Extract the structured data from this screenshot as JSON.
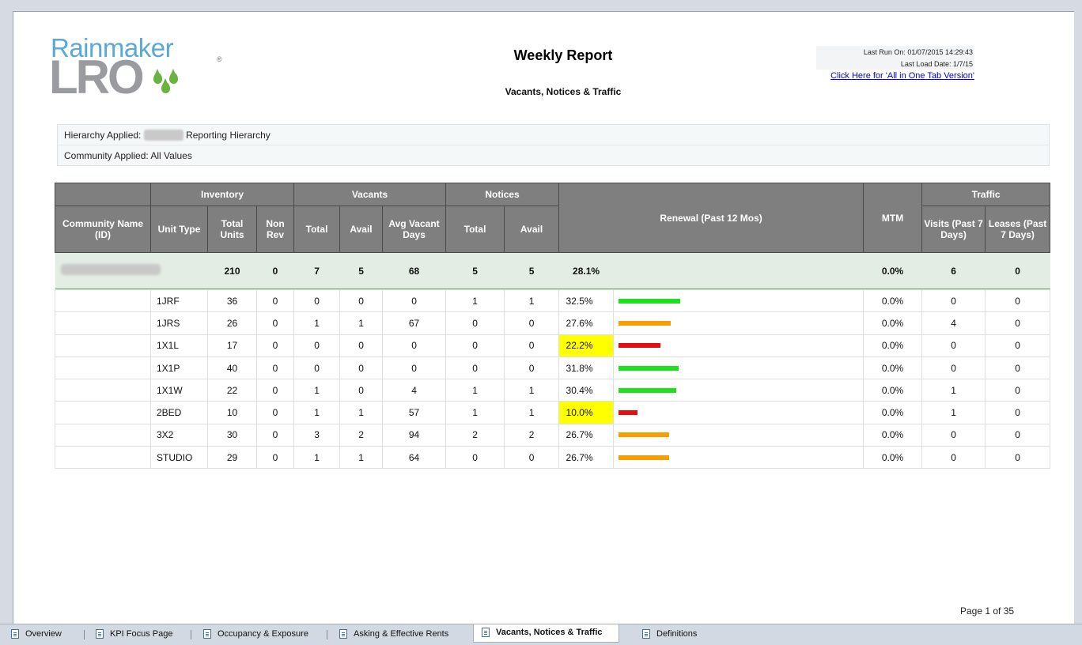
{
  "header": {
    "logo_top": "Rainmaker",
    "logo_bottom": "LRO",
    "logo_reg": "®",
    "title": "Weekly Report",
    "subtitle": "Vacants, Notices & Traffic",
    "last_run": "Last Run On: 01/07/2015 14:29:43",
    "last_load": "Last Load Date: 1/7/15",
    "all_in_one_link": "Click Here for 'All in One Tab Version'"
  },
  "filters": {
    "hierarchy_label": "Hierarchy Applied:",
    "hierarchy_value": "Reporting Hierarchy",
    "community_text": "Community Applied: All Values"
  },
  "table": {
    "groups": {
      "inventory": "Inventory",
      "vacants": "Vacants",
      "notices": "Notices",
      "renewal": "Renewal (Past 12 Mos)",
      "mtm": "MTM",
      "traffic": "Traffic"
    },
    "columns": {
      "community": "Community Name (ID)",
      "unit_type": "Unit Type",
      "total_units": "Total Units",
      "non_rev": "Non Rev",
      "vac_total": "Total",
      "vac_avail": "Avail",
      "avg_vacant_days": "Avg Vacant Days",
      "not_total": "Total",
      "not_avail": "Avail",
      "visits": "Visits (Past 7 Days)",
      "leases": "Leases (Past 7 Days)"
    },
    "summary": {
      "total_units": "210",
      "non_rev": "0",
      "vac_total": "7",
      "vac_avail": "5",
      "avg_vacant_days": "68",
      "not_total": "5",
      "not_avail": "5",
      "renewal": "28.1%",
      "mtm": "0.0%",
      "visits": "6",
      "leases": "0"
    },
    "rows": [
      {
        "unit_type": "1JRF",
        "total_units": "36",
        "non_rev": "0",
        "vac_total": "0",
        "vac_avail": "0",
        "avg_vacant_days": "0",
        "not_total": "1",
        "not_avail": "1",
        "renewal": "32.5%",
        "renewal_value": 32.5,
        "bar_color": "#1de11d",
        "highlight": false,
        "mtm": "0.0%",
        "visits": "0",
        "leases": "0"
      },
      {
        "unit_type": "1JRS",
        "total_units": "26",
        "non_rev": "0",
        "vac_total": "1",
        "vac_avail": "1",
        "avg_vacant_days": "67",
        "not_total": "0",
        "not_avail": "0",
        "renewal": "27.6%",
        "renewal_value": 27.6,
        "bar_color": "#f5a000",
        "highlight": false,
        "mtm": "0.0%",
        "visits": "4",
        "leases": "0"
      },
      {
        "unit_type": "1X1L",
        "total_units": "17",
        "non_rev": "0",
        "vac_total": "0",
        "vac_avail": "0",
        "avg_vacant_days": "0",
        "not_total": "0",
        "not_avail": "0",
        "renewal": "22.2%",
        "renewal_value": 22.2,
        "bar_color": "#e41010",
        "highlight": true,
        "mtm": "0.0%",
        "visits": "0",
        "leases": "0"
      },
      {
        "unit_type": "1X1P",
        "total_units": "40",
        "non_rev": "0",
        "vac_total": "0",
        "vac_avail": "0",
        "avg_vacant_days": "0",
        "not_total": "0",
        "not_avail": "0",
        "renewal": "31.8%",
        "renewal_value": 31.8,
        "bar_color": "#1de11d",
        "highlight": false,
        "mtm": "0.0%",
        "visits": "0",
        "leases": "0"
      },
      {
        "unit_type": "1X1W",
        "total_units": "22",
        "non_rev": "0",
        "vac_total": "1",
        "vac_avail": "0",
        "avg_vacant_days": "4",
        "not_total": "1",
        "not_avail": "1",
        "renewal": "30.4%",
        "renewal_value": 30.4,
        "bar_color": "#1de11d",
        "highlight": false,
        "mtm": "0.0%",
        "visits": "1",
        "leases": "0"
      },
      {
        "unit_type": "2BED",
        "total_units": "10",
        "non_rev": "0",
        "vac_total": "1",
        "vac_avail": "1",
        "avg_vacant_days": "57",
        "not_total": "1",
        "not_avail": "1",
        "renewal": "10.0%",
        "renewal_value": 10.0,
        "bar_color": "#e41010",
        "highlight": true,
        "mtm": "0.0%",
        "visits": "1",
        "leases": "0"
      },
      {
        "unit_type": "3X2",
        "total_units": "30",
        "non_rev": "0",
        "vac_total": "3",
        "vac_avail": "2",
        "avg_vacant_days": "94",
        "not_total": "2",
        "not_avail": "2",
        "renewal": "26.7%",
        "renewal_value": 26.7,
        "bar_color": "#f5a000",
        "highlight": false,
        "mtm": "0.0%",
        "visits": "0",
        "leases": "0"
      },
      {
        "unit_type": "STUDIO",
        "total_units": "29",
        "non_rev": "0",
        "vac_total": "1",
        "vac_avail": "1",
        "avg_vacant_days": "64",
        "not_total": "0",
        "not_avail": "0",
        "renewal": "26.7%",
        "renewal_value": 26.7,
        "bar_color": "#f5a000",
        "highlight": false,
        "mtm": "0.0%",
        "visits": "0",
        "leases": "0"
      }
    ]
  },
  "pager": "Page 1 of 35",
  "tabs": [
    {
      "label": "Overview",
      "active": false
    },
    {
      "label": "KPI Focus Page",
      "active": false
    },
    {
      "label": "Occupancy & Exposure",
      "active": false
    },
    {
      "label": "Asking & Effective Rents",
      "active": false
    },
    {
      "label": "Vacants, Notices & Traffic",
      "active": true
    },
    {
      "label": "Definitions",
      "active": false
    }
  ]
}
